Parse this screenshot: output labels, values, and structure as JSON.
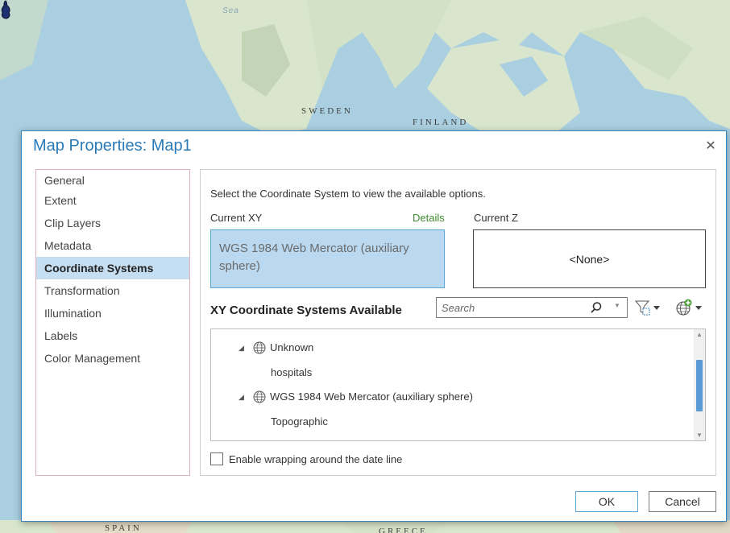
{
  "map": {
    "labels": {
      "sea": "Sea",
      "sweden": "SWEDEN",
      "finland": "FINLAND",
      "spain": "SPAIN",
      "greece": "GREECE"
    },
    "colors": {
      "land": "#d9e6cd",
      "water": "#a9cfe0",
      "mountain": "#c3d5b6"
    }
  },
  "dialog": {
    "title": "Map Properties: Map1",
    "close_icon": "close-icon",
    "nav": {
      "items": [
        {
          "label": "General"
        },
        {
          "label": "Extent"
        },
        {
          "label": "Clip Layers"
        },
        {
          "label": "Metadata"
        },
        {
          "label": "Coordinate Systems",
          "selected": true
        },
        {
          "label": "Transformation"
        },
        {
          "label": "Illumination"
        },
        {
          "label": "Labels"
        },
        {
          "label": "Color Management"
        }
      ]
    },
    "coordinate_systems": {
      "instruction": "Select the Coordinate System to view the available options.",
      "current_xy_label": "Current XY",
      "details_link": "Details",
      "current_z_label": "Current Z",
      "current_xy_value": "WGS 1984 Web Mercator (auxiliary sphere)",
      "current_z_value": "<None>",
      "available_heading": "XY Coordinate Systems Available",
      "search": {
        "placeholder": "Search",
        "value": ""
      },
      "tree": [
        {
          "type": "group",
          "label": "Unknown",
          "expanded": true,
          "icon": "globe-icon"
        },
        {
          "type": "leaf",
          "label": "hospitals"
        },
        {
          "type": "group",
          "label": "WGS 1984 Web Mercator (auxiliary sphere)",
          "expanded": true,
          "icon": "globe-icon"
        },
        {
          "type": "leaf",
          "label": "Topographic"
        }
      ],
      "wrap_checkbox": {
        "label": "Enable wrapping around the date line",
        "checked": false
      }
    },
    "buttons": {
      "ok": "OK",
      "cancel": "Cancel"
    },
    "colors": {
      "accent": "#2a7ab7",
      "selected_bg": "#c6def1",
      "details_link": "#3f8c2e"
    }
  }
}
